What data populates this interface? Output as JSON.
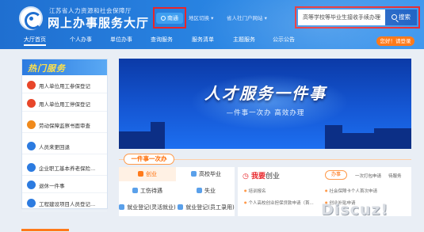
{
  "header": {
    "org_name": "江苏省人力资源和社会保障厅",
    "site_title": "网上办事服务大厅",
    "city": "南通",
    "region_toggle": "地区切换 ▾",
    "prov_portal": "省人社门户网站 ▾",
    "search": {
      "value": "高等学校等毕业生接收手续办理",
      "button_label": "搜索"
    }
  },
  "nav": {
    "items": [
      "大厅首页",
      "个人办事",
      "单位办事",
      "查询服务",
      "服务清单",
      "主题服务",
      "公示公告"
    ],
    "login": "您好！请登录"
  },
  "hot": {
    "title": "热门服务",
    "items": [
      {
        "label": "用人单位用工参保登记",
        "icon": "person-icon",
        "color": "#e8462a"
      },
      {
        "label": "用人单位用工停保登记",
        "icon": "person-icon",
        "color": "#e8462a"
      },
      {
        "label": "劳动保障监察书面审查",
        "icon": "shield-icon",
        "color": "#f08a1c"
      },
      {
        "label": "人员来更回退",
        "icon": "refresh-icon",
        "color": "#2c7be0"
      },
      {
        "label": "企业职工基本养老保险...",
        "icon": "gear-icon",
        "color": "#2c7be0"
      },
      {
        "label": "退休一件事",
        "icon": "badge-icon",
        "color": "#2c7be0"
      },
      {
        "label": "工程建设项目人员登记...",
        "icon": "building-icon",
        "color": "#2c7be0"
      }
    ]
  },
  "banner": {
    "title": "人才服务一件事",
    "subtitle": "—件事一次办  高效办理"
  },
  "onething": {
    "tab": "一件事一次办",
    "categories": [
      "创业",
      "高校毕业",
      "工伤待遇",
      "失业",
      "就业登记(灵活就业)",
      "就业登记(员工录用)"
    ],
    "iwant": {
      "title": "我要",
      "title_sub": "创业",
      "button": "办事",
      "links": [
        "一次打包申请",
        "待服务"
      ],
      "rows": [
        "培训报名",
        "个人高校创业担保贷款申请（首...",
        "社会保障卡个人首次申请",
        "创业补贴申请"
      ]
    }
  },
  "watermark": "Discuz!",
  "colors": {
    "primary": "#1f6fd0",
    "accent": "#ff7a1a",
    "highlight": "#e8262a"
  }
}
